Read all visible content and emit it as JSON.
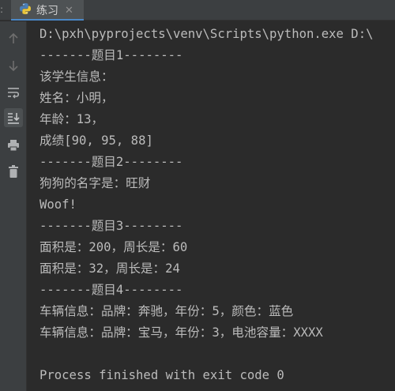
{
  "tab": {
    "label": "练习"
  },
  "toolbar": {
    "items": [
      {
        "icon": "arrow-up-icon"
      },
      {
        "icon": "arrow-down-icon"
      },
      {
        "icon": "soft-wrap-icon"
      },
      {
        "icon": "scroll-to-end-icon"
      },
      {
        "icon": "print-icon"
      },
      {
        "icon": "trash-icon"
      }
    ]
  },
  "console": {
    "lines": [
      "D:\\pxh\\pyprojects\\venv\\Scripts\\python.exe D:\\",
      "-------题目1--------",
      "该学生信息：",
      "姓名：小明，",
      "年龄：13，",
      "成绩[90, 95, 88]",
      "-------题目2--------",
      "狗狗的名字是：旺财",
      "Woof!",
      "-------题目3--------",
      "面积是：200，周长是：60",
      "面积是：32，周长是：24",
      "-------题目4--------",
      "车辆信息：品牌：奔驰，年份：5，颜色：蓝色",
      "车辆信息：品牌：宝马，年份：3，电池容量：XXXX",
      "",
      "Process finished with exit code 0"
    ]
  }
}
